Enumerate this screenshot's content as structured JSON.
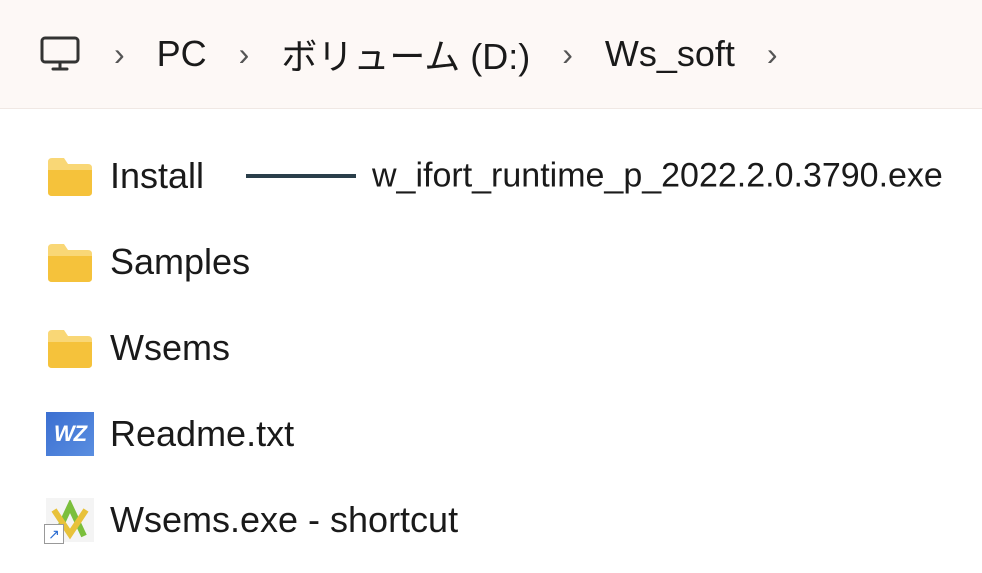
{
  "breadcrumb": {
    "items": [
      "PC",
      "ボリューム (D:)",
      "Ws_soft"
    ]
  },
  "files": [
    {
      "name": "Install",
      "type": "folder"
    },
    {
      "name": "Samples",
      "type": "folder"
    },
    {
      "name": "Wsems",
      "type": "folder"
    },
    {
      "name": "Readme.txt",
      "type": "wz"
    },
    {
      "name": "Wsems.exe - shortcut",
      "type": "shortcut"
    }
  ],
  "annotation": {
    "target_index": 0,
    "text": "w_ifort_runtime_p_2022.2.0.3790.exe"
  },
  "icons": {
    "wz_badge": "WZ"
  }
}
